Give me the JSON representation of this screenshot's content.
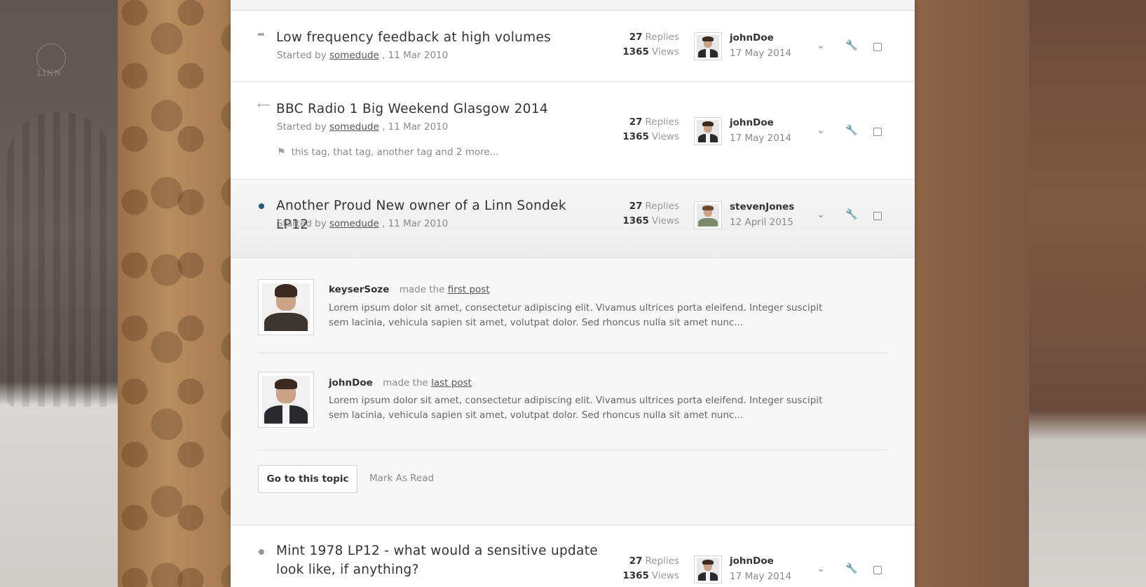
{
  "background": {
    "logo_text": "LINN"
  },
  "topics": [
    {
      "status_icon": "forward-arrow-icon",
      "title": "Low frequency feedback at high volumes",
      "started_prefix": "Started by",
      "author": "somedude",
      "date": ", 11 Mar 2010",
      "replies_count": "27",
      "replies_label": "Replies",
      "views_count": "1365",
      "views_label": "Views",
      "last_user": "johnDoe",
      "last_date": "17 May 2014"
    },
    {
      "status_icon": "back-arrow-icon",
      "title": "BBC Radio 1 Big Weekend Glasgow 2014",
      "started_prefix": "Started by",
      "author": "somedude",
      "date": ", 11 Mar 2010",
      "tags": "this tag, that tag, another tag and 2 more...",
      "replies_count": "27",
      "replies_label": "Replies",
      "views_count": "1365",
      "views_label": "Views",
      "last_user": "johnDoe",
      "last_date": "17 May 2014"
    },
    {
      "status_icon": "unread-dot-icon",
      "title": "Another Proud New owner of a Linn Sondek LP12",
      "started_prefix": "Started by",
      "author": "somedude",
      "date": ", 11 Mar 2010",
      "replies_count": "27",
      "replies_label": "Replies",
      "views_count": "1365",
      "views_label": "Views",
      "last_user": "stevenJones",
      "last_date": "12 April 2015"
    },
    {
      "status_icon": "read-dot-icon",
      "title": "Mint 1978 LP12 - what would a sensitive update look like, if anything?",
      "replies_count": "27",
      "replies_label": "Replies",
      "views_count": "1365",
      "views_label": "Views",
      "last_user": "johnDoe",
      "last_date": "17 May 2014"
    }
  ],
  "expanded": {
    "first": {
      "user": "keyserSoze",
      "action": "made the",
      "link": "first post",
      "excerpt": "Lorem ipsum dolor sit amet, consectetur adipiscing elit. Vivamus ultrices porta eleifend. Integer suscipit sem lacinia, vehicula sapien sit amet, volutpat dolor. Sed rhoncus nulla sit amet nunc..."
    },
    "last": {
      "user": "johnDoe",
      "action": "made the",
      "link": "last post",
      "excerpt": "Lorem ipsum dolor sit amet, consectetur adipiscing elit. Vivamus ultrices porta eleifend. Integer suscipit sem lacinia, vehicula sapien sit amet, volutpat dolor. Sed rhoncus nulla sit amet nunc..."
    },
    "go_button": "Go to this topic",
    "mark_read": "Mark As Read"
  },
  "colors": {
    "unread_dot": "#1f5f7a",
    "read_dot": "#9a9a9a"
  }
}
